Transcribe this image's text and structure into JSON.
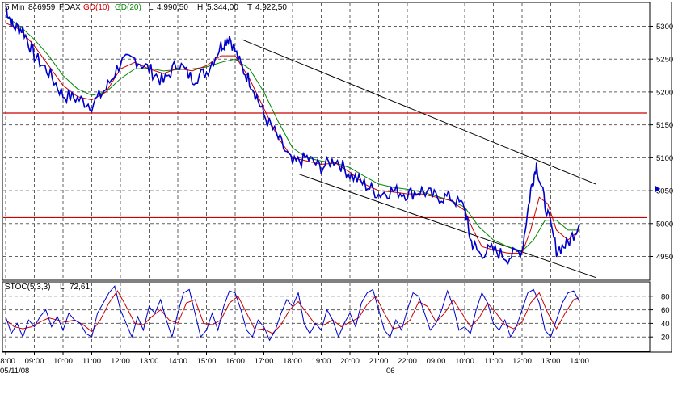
{
  "header": {
    "interval": "5 Min",
    "symbol_code": "846959",
    "symbol": "FDAX",
    "ma1_label": "GD(10)",
    "ma2_label": "GD(20)",
    "low_label": "L",
    "low_value": "4.990,50",
    "high_label": "H",
    "high_value": "5.344,00",
    "close_label": "T",
    "close_value": "4.922,50"
  },
  "stoch_header": {
    "label": "STOC(5,3,3)",
    "last_label": "L",
    "last_value": "72,61"
  },
  "date_labels": {
    "start": "05/11/08",
    "next_day": "06"
  },
  "colors": {
    "price": "#0000cc",
    "ma10": "#cc0000",
    "ma20": "#008800",
    "hline": "#cc0000",
    "channel": "#000000",
    "grid": "#606060"
  },
  "chart_data": [
    {
      "type": "line",
      "name": "FDAX 5 Min price",
      "x_ticks": [
        "08:00",
        "09:00",
        "10:00",
        "11:00",
        "12:00",
        "13:00",
        "14:00",
        "15:00",
        "16:00",
        "17:00",
        "18:00",
        "19:00",
        "20:00",
        "21:00",
        "22:00",
        "09:00",
        "10:00",
        "11:00",
        "12:00",
        "13:00",
        "14:00"
      ],
      "y_ticks": [
        4950,
        5000,
        5050,
        5100,
        5150,
        5200,
        5250,
        5300
      ],
      "ylim": [
        4915,
        5335
      ],
      "horizontal_lines": [
        5168,
        5009
      ],
      "trend_lines": [
        {
          "from": [
            "16:00",
            5280
          ],
          "to": [
            "14:00",
            5060
          ]
        },
        {
          "from": [
            "18:00",
            5075
          ],
          "to": [
            "14:00",
            4918
          ]
        }
      ],
      "price_path": [
        [
          0,
          5330
        ],
        [
          0.25,
          5300
        ],
        [
          0.6,
          5295
        ],
        [
          1,
          5255
        ],
        [
          1.5,
          5230
        ],
        [
          2,
          5195
        ],
        [
          2.5,
          5190
        ],
        [
          3,
          5180
        ],
        [
          3.5,
          5205
        ],
        [
          4,
          5245
        ],
        [
          4.5,
          5250
        ],
        [
          5,
          5235
        ],
        [
          5.5,
          5215
        ],
        [
          6,
          5245
        ],
        [
          6.5,
          5220
        ],
        [
          7,
          5230
        ],
        [
          7.5,
          5270
        ],
        [
          7.8,
          5285
        ],
        [
          8.2,
          5240
        ],
        [
          8.6,
          5210
        ],
        [
          9,
          5165
        ],
        [
          9.5,
          5130
        ],
        [
          10,
          5090
        ],
        [
          10.5,
          5100
        ],
        [
          11,
          5085
        ],
        [
          11.5,
          5098
        ],
        [
          12,
          5075
        ],
        [
          12.5,
          5060
        ],
        [
          13,
          5045
        ],
        [
          13.5,
          5050
        ],
        [
          14,
          5045
        ],
        [
          14.5,
          5050
        ],
        [
          15,
          5040
        ],
        [
          15.5,
          5040
        ],
        [
          16,
          5025
        ],
        [
          16.2,
          4975
        ],
        [
          16.5,
          4955
        ],
        [
          17,
          4960
        ],
        [
          17.5,
          4948
        ],
        [
          18,
          4960
        ],
        [
          18.3,
          5050
        ],
        [
          18.5,
          5090
        ],
        [
          18.8,
          5030
        ],
        [
          19.2,
          4960
        ],
        [
          19.6,
          4970
        ],
        [
          20,
          5000
        ]
      ],
      "ma10_path": [
        [
          0,
          5305
        ],
        [
          0.5,
          5295
        ],
        [
          1,
          5270
        ],
        [
          1.5,
          5240
        ],
        [
          2,
          5210
        ],
        [
          2.5,
          5193
        ],
        [
          3,
          5188
        ],
        [
          3.5,
          5200
        ],
        [
          4,
          5235
        ],
        [
          4.5,
          5245
        ],
        [
          5,
          5235
        ],
        [
          5.5,
          5228
        ],
        [
          6,
          5236
        ],
        [
          6.5,
          5232
        ],
        [
          7,
          5240
        ],
        [
          7.5,
          5255
        ],
        [
          8,
          5255
        ],
        [
          8.5,
          5220
        ],
        [
          9,
          5175
        ],
        [
          9.5,
          5130
        ],
        [
          10,
          5100
        ],
        [
          10.5,
          5095
        ],
        [
          11,
          5090
        ],
        [
          11.5,
          5092
        ],
        [
          12,
          5078
        ],
        [
          12.5,
          5060
        ],
        [
          13,
          5050
        ],
        [
          13.5,
          5048
        ],
        [
          14,
          5045
        ],
        [
          14.5,
          5045
        ],
        [
          15,
          5040
        ],
        [
          15.5,
          5035
        ],
        [
          16,
          5020
        ],
        [
          16.3,
          4990
        ],
        [
          16.6,
          4965
        ],
        [
          17,
          4960
        ],
        [
          17.5,
          4955
        ],
        [
          18,
          4955
        ],
        [
          18.3,
          4990
        ],
        [
          18.6,
          5040
        ],
        [
          18.9,
          5030
        ],
        [
          19.2,
          4990
        ],
        [
          19.6,
          4975
        ],
        [
          20,
          4990
        ]
      ],
      "ma20_path": [
        [
          0,
          5315
        ],
        [
          0.5,
          5300
        ],
        [
          1,
          5280
        ],
        [
          1.5,
          5255
        ],
        [
          2,
          5225
        ],
        [
          2.5,
          5205
        ],
        [
          3,
          5195
        ],
        [
          3.5,
          5200
        ],
        [
          4,
          5220
        ],
        [
          4.5,
          5235
        ],
        [
          5,
          5236
        ],
        [
          5.5,
          5232
        ],
        [
          6,
          5234
        ],
        [
          6.5,
          5235
        ],
        [
          7,
          5238
        ],
        [
          7.5,
          5245
        ],
        [
          8,
          5250
        ],
        [
          8.5,
          5235
        ],
        [
          9,
          5200
        ],
        [
          9.5,
          5155
        ],
        [
          10,
          5115
        ],
        [
          10.5,
          5100
        ],
        [
          11,
          5095
        ],
        [
          11.5,
          5092
        ],
        [
          12,
          5085
        ],
        [
          12.5,
          5072
        ],
        [
          13,
          5060
        ],
        [
          13.5,
          5055
        ],
        [
          14,
          5052
        ],
        [
          14.5,
          5048
        ],
        [
          15,
          5042
        ],
        [
          15.5,
          5035
        ],
        [
          16,
          5025
        ],
        [
          16.5,
          4995
        ],
        [
          17,
          4975
        ],
        [
          17.5,
          4965
        ],
        [
          18,
          4958
        ],
        [
          18.4,
          4975
        ],
        [
          18.8,
          5005
        ],
        [
          19.2,
          5005
        ],
        [
          19.6,
          4990
        ],
        [
          20,
          4990
        ]
      ]
    },
    {
      "type": "line",
      "name": "STOC(5,3,3)",
      "y_ticks": [
        20,
        40,
        60,
        80
      ],
      "ylim": [
        0,
        100
      ],
      "k_path": [
        [
          0,
          50
        ],
        [
          0.2,
          25
        ],
        [
          0.4,
          40
        ],
        [
          0.6,
          20
        ],
        [
          0.8,
          45
        ],
        [
          1,
          35
        ],
        [
          1.2,
          50
        ],
        [
          1.4,
          60
        ],
        [
          1.6,
          35
        ],
        [
          1.8,
          50
        ],
        [
          2,
          30
        ],
        [
          2.2,
          55
        ],
        [
          2.4,
          45
        ],
        [
          2.6,
          40
        ],
        [
          2.8,
          25
        ],
        [
          3,
          20
        ],
        [
          3.2,
          55
        ],
        [
          3.4,
          70
        ],
        [
          3.6,
          85
        ],
        [
          3.8,
          95
        ],
        [
          4,
          60
        ],
        [
          4.2,
          40
        ],
        [
          4.4,
          20
        ],
        [
          4.6,
          50
        ],
        [
          4.8,
          30
        ],
        [
          5,
          65
        ],
        [
          5.2,
          55
        ],
        [
          5.4,
          75
        ],
        [
          5.6,
          45
        ],
        [
          5.8,
          20
        ],
        [
          6,
          55
        ],
        [
          6.2,
          85
        ],
        [
          6.4,
          90
        ],
        [
          6.6,
          55
        ],
        [
          6.8,
          20
        ],
        [
          7,
          30
        ],
        [
          7.2,
          55
        ],
        [
          7.4,
          30
        ],
        [
          7.6,
          65
        ],
        [
          7.8,
          88
        ],
        [
          8,
          85
        ],
        [
          8.2,
          60
        ],
        [
          8.4,
          30
        ],
        [
          8.6,
          20
        ],
        [
          8.8,
          45
        ],
        [
          9,
          35
        ],
        [
          9.2,
          15
        ],
        [
          9.4,
          30
        ],
        [
          9.6,
          55
        ],
        [
          9.8,
          75
        ],
        [
          10,
          65
        ],
        [
          10.2,
          85
        ],
        [
          10.4,
          40
        ],
        [
          10.6,
          25
        ],
        [
          10.8,
          40
        ],
        [
          11,
          30
        ],
        [
          11.2,
          60
        ],
        [
          11.4,
          45
        ],
        [
          11.6,
          20
        ],
        [
          11.8,
          40
        ],
        [
          12,
          55
        ],
        [
          12.2,
          35
        ],
        [
          12.4,
          70
        ],
        [
          12.6,
          85
        ],
        [
          12.8,
          90
        ],
        [
          13,
          60
        ],
        [
          13.2,
          30
        ],
        [
          13.4,
          20
        ],
        [
          13.6,
          45
        ],
        [
          13.8,
          30
        ],
        [
          14,
          60
        ],
        [
          14.2,
          85
        ],
        [
          14.4,
          80
        ],
        [
          14.6,
          55
        ],
        [
          14.8,
          30
        ],
        [
          15,
          40
        ],
        [
          15.2,
          60
        ],
        [
          15.4,
          88
        ],
        [
          15.6,
          65
        ],
        [
          15.8,
          30
        ],
        [
          16,
          35
        ],
        [
          16.2,
          25
        ],
        [
          16.4,
          60
        ],
        [
          16.6,
          85
        ],
        [
          16.8,
          70
        ],
        [
          17,
          40
        ],
        [
          17.2,
          30
        ],
        [
          17.4,
          45
        ],
        [
          17.6,
          20
        ],
        [
          17.8,
          35
        ],
        [
          18,
          60
        ],
        [
          18.2,
          85
        ],
        [
          18.4,
          90
        ],
        [
          18.6,
          70
        ],
        [
          18.8,
          30
        ],
        [
          19,
          20
        ],
        [
          19.2,
          45
        ],
        [
          19.4,
          70
        ],
        [
          19.6,
          85
        ],
        [
          19.8,
          88
        ],
        [
          20,
          72
        ]
      ],
      "d_path": [
        [
          0,
          45
        ],
        [
          0.3,
          35
        ],
        [
          0.6,
          32
        ],
        [
          0.9,
          35
        ],
        [
          1.2,
          42
        ],
        [
          1.5,
          48
        ],
        [
          1.8,
          45
        ],
        [
          2.1,
          42
        ],
        [
          2.4,
          45
        ],
        [
          2.7,
          38
        ],
        [
          3,
          28
        ],
        [
          3.3,
          45
        ],
        [
          3.6,
          70
        ],
        [
          3.9,
          88
        ],
        [
          4.2,
          65
        ],
        [
          4.5,
          40
        ],
        [
          4.8,
          38
        ],
        [
          5.1,
          50
        ],
        [
          5.4,
          60
        ],
        [
          5.7,
          45
        ],
        [
          6,
          40
        ],
        [
          6.3,
          70
        ],
        [
          6.6,
          75
        ],
        [
          6.9,
          40
        ],
        [
          7.2,
          38
        ],
        [
          7.5,
          45
        ],
        [
          7.8,
          70
        ],
        [
          8.1,
          80
        ],
        [
          8.4,
          55
        ],
        [
          8.7,
          30
        ],
        [
          9,
          32
        ],
        [
          9.3,
          25
        ],
        [
          9.6,
          38
        ],
        [
          9.9,
          60
        ],
        [
          10.2,
          72
        ],
        [
          10.5,
          55
        ],
        [
          10.8,
          38
        ],
        [
          11.1,
          38
        ],
        [
          11.4,
          45
        ],
        [
          11.7,
          35
        ],
        [
          12,
          42
        ],
        [
          12.3,
          48
        ],
        [
          12.6,
          68
        ],
        [
          12.9,
          80
        ],
        [
          13.2,
          55
        ],
        [
          13.5,
          32
        ],
        [
          13.8,
          35
        ],
        [
          14.1,
          45
        ],
        [
          14.4,
          72
        ],
        [
          14.7,
          65
        ],
        [
          15,
          42
        ],
        [
          15.3,
          55
        ],
        [
          15.6,
          75
        ],
        [
          15.9,
          55
        ],
        [
          16.2,
          35
        ],
        [
          16.5,
          48
        ],
        [
          16.8,
          70
        ],
        [
          17.1,
          55
        ],
        [
          17.4,
          38
        ],
        [
          17.7,
          32
        ],
        [
          18,
          42
        ],
        [
          18.3,
          70
        ],
        [
          18.6,
          85
        ],
        [
          18.9,
          55
        ],
        [
          19.2,
          32
        ],
        [
          19.5,
          55
        ],
        [
          19.8,
          75
        ],
        [
          20,
          78
        ]
      ]
    }
  ]
}
